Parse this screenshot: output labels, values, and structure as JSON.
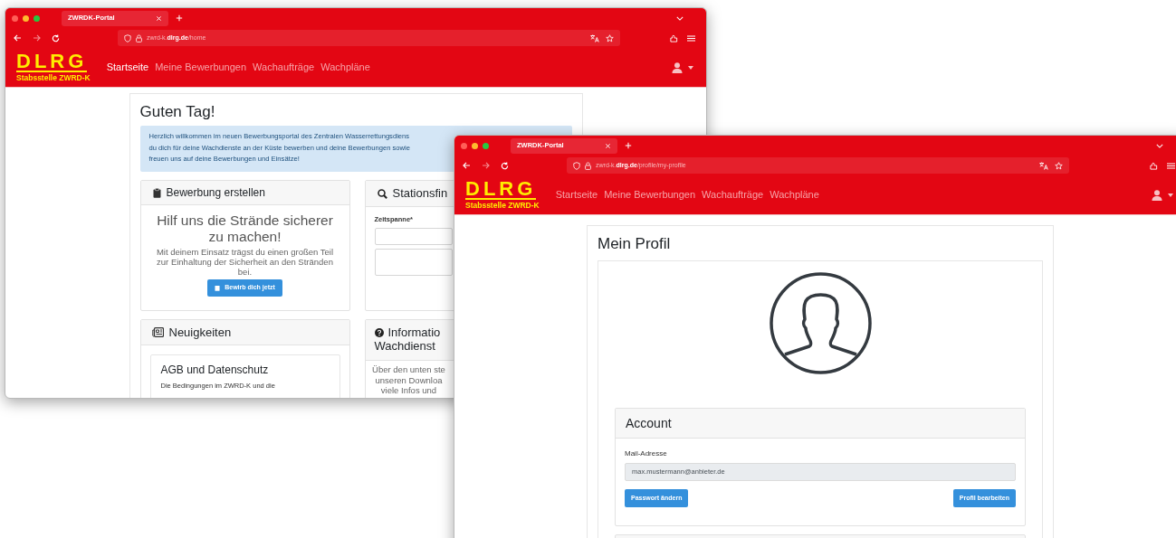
{
  "home_window": {
    "browser": {
      "tab_title": "ZWRDK-Portal",
      "url": {
        "prefix": "zwrd-k.",
        "domain": "dlrg.de",
        "path": "/home"
      }
    },
    "site_header": {
      "logo": "DLRG",
      "logo_subtitle": "Stabsstelle ZWRD-K",
      "nav": [
        {
          "label": "Startseite",
          "selected": true
        },
        {
          "label": "Meine Bewerbungen",
          "selected": false
        },
        {
          "label": "Wachaufträge",
          "selected": false
        },
        {
          "label": "Wachpläne",
          "selected": false
        }
      ]
    },
    "greeting": "Guten Tag!",
    "welcome_lines": [
      "Herzlich willkommen im neuen Bewerbungsportal des Zentralen Wasserrettungsdiens",
      "du dich für deine Wachdienste an der Küste bewerben und deine Bewerbungen sowie",
      "freuen uns auf deine Bewerbungen und Einsätze!"
    ],
    "apply_card": {
      "title": "Bewerbung erstellen",
      "headline": "Hilf uns die Strände sicherer zu machen!",
      "text": "Mit deinem Einsatz trägst du einen großen Teil zur Einhaltung der Sicherheit an den Stränden bei.",
      "button": "Bewirb dich jetzt"
    },
    "station_card": {
      "title": "Stationsfin",
      "field_label": "Zeitspanne*"
    },
    "news_card": {
      "title": "Neuigkeiten",
      "article_title": "AGB und Datenschutz",
      "article_text": "Die Bedingungen im ZWRD-K und die"
    },
    "info_card": {
      "title_lines": [
        "Informatio",
        "Wachdienst"
      ],
      "text_lines": [
        "Über den unten ste",
        "unseren Downloa",
        "viele Infos und"
      ]
    }
  },
  "profile_window": {
    "browser": {
      "tab_title": "ZWRDK-Portal",
      "url": {
        "prefix": "zwrd-k.",
        "domain": "dlrg.de",
        "path": "/profile/my-profile"
      }
    },
    "site_header": {
      "logo": "DLRG",
      "logo_subtitle": "Stabsstelle ZWRD-K",
      "nav": [
        {
          "label": "Startseite",
          "selected": false
        },
        {
          "label": "Meine Bewerbungen",
          "selected": false
        },
        {
          "label": "Wachaufträge",
          "selected": false
        },
        {
          "label": "Wachpläne",
          "selected": false
        }
      ]
    },
    "page_title": "Mein Profil",
    "account_card": {
      "title": "Account",
      "field_label": "Mail-Adresse",
      "email": "max.mustermann@anbieter.de",
      "buttons": [
        "Passwort ändern",
        "Profil bearbeiten"
      ]
    }
  }
}
